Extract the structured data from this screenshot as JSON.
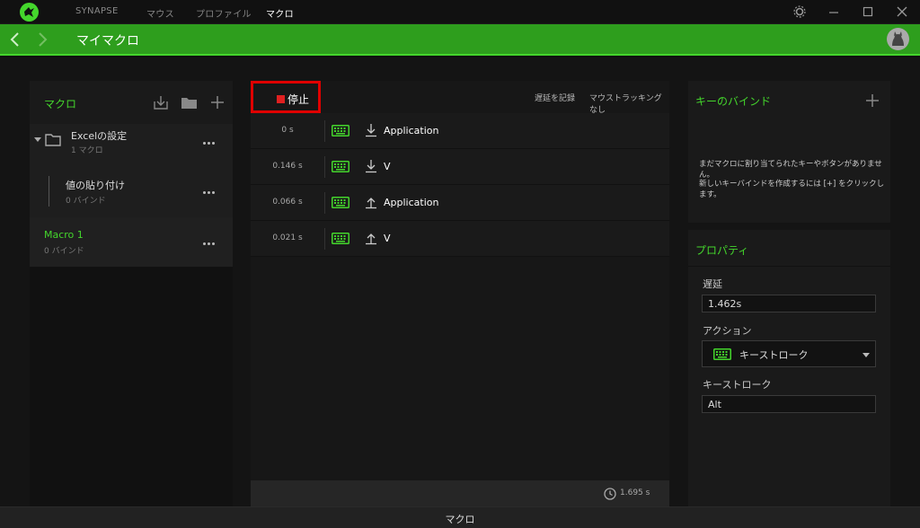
{
  "nav": {
    "tabs": [
      "SYNAPSE",
      "マウス",
      "プロファイル",
      "マクロ"
    ]
  },
  "header": {
    "title": "マイマクロ"
  },
  "macros": {
    "title": "マクロ",
    "group": {
      "name": "Excelの設定",
      "count": "1 マクロ"
    },
    "child": {
      "name": "値の貼り付け",
      "binds": "0 バインド"
    },
    "selected": {
      "name": "Macro 1",
      "binds": "0 バインド"
    }
  },
  "editor": {
    "stop_label": "停止",
    "record_delay": "遅延を記録",
    "mouse_tracking": "マウストラッキングなし",
    "events": [
      {
        "delay": "0 s",
        "direction": "down",
        "key": "Application"
      },
      {
        "delay": "0.146 s",
        "direction": "down",
        "key": "V"
      },
      {
        "delay": "0.066 s",
        "direction": "up",
        "key": "Application"
      },
      {
        "delay": "0.021 s",
        "direction": "up",
        "key": "V"
      }
    ],
    "total_time": "1.695 s"
  },
  "keybind": {
    "title": "キーのバインド",
    "message1": "まだマクロに割り当てられたキーやボタンがありません。",
    "message2": "新しいキーバインドを作成するには [+] をクリックします。"
  },
  "properties": {
    "title": "プロパティ",
    "delay_label": "遅延",
    "delay_value": "1.462s",
    "action_label": "アクション",
    "action_value": "キーストローク",
    "keystroke_label": "キーストローク",
    "keystroke_value": "Alt"
  },
  "footer": {
    "label": "マクロ"
  },
  "colors": {
    "accent": "#44d62c",
    "header": "#2e9e1d",
    "stop": "#e00000"
  }
}
